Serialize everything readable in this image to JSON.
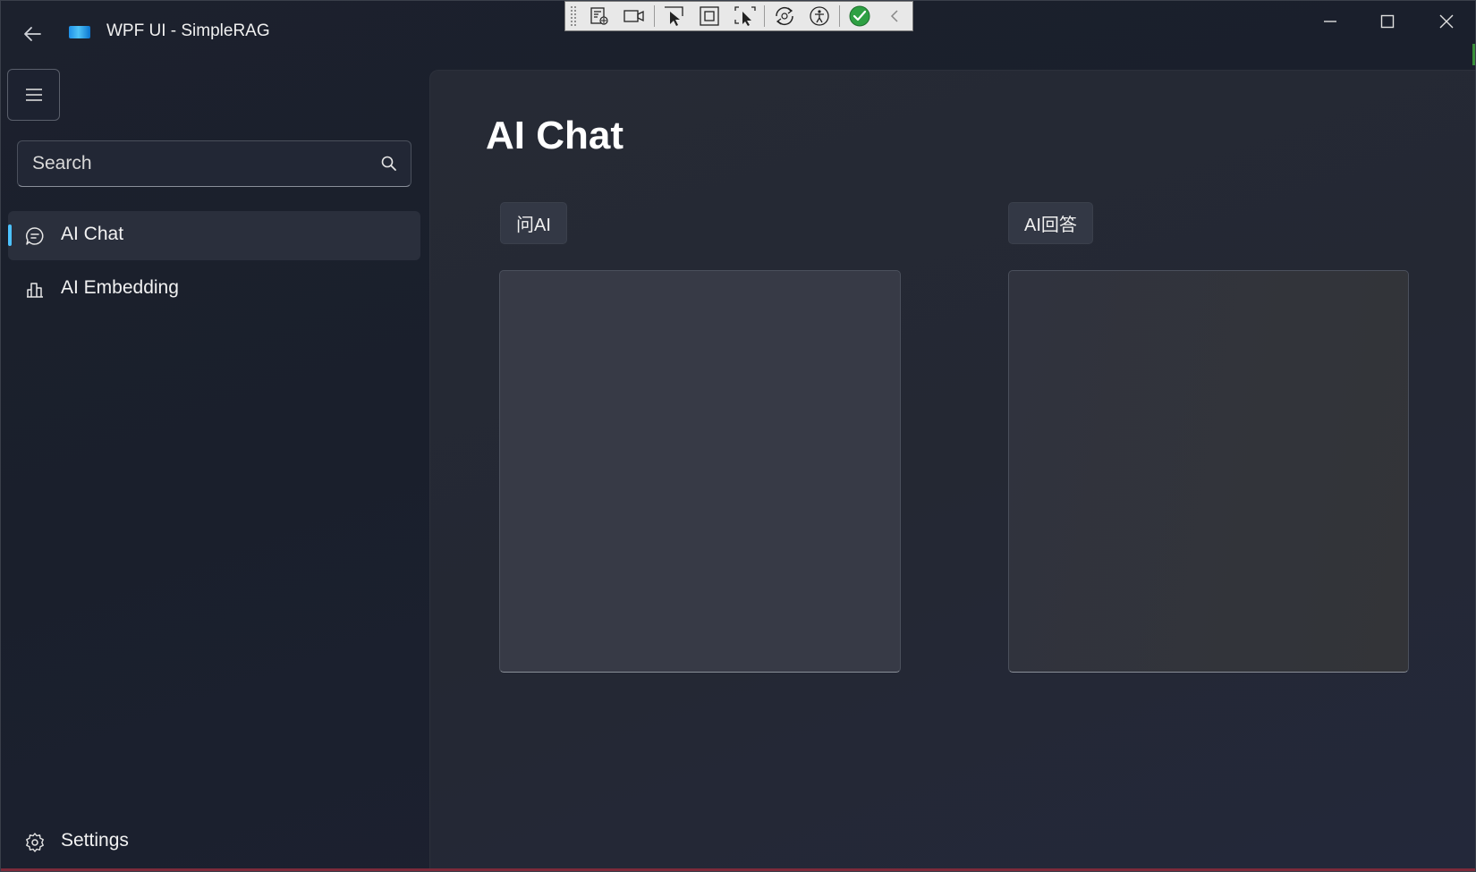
{
  "window": {
    "title": "WPF UI - SimpleRAG",
    "controls": {
      "minimize": "minimize-icon",
      "maximize": "maximize-icon",
      "close": "close-icon"
    }
  },
  "debug_toolbar": {
    "buttons": [
      "live-visual-tree-icon",
      "record-icon",
      "select-element-icon",
      "display-layout-adorners-icon",
      "track-focus-icon",
      "hot-reload-icon",
      "accessibility-icon",
      "binding-check-icon",
      "collapse-chevron-icon"
    ]
  },
  "sidebar": {
    "menu_icon": "hamburger-icon",
    "search": {
      "placeholder": "Search"
    },
    "items": [
      {
        "label": "AI Chat",
        "icon": "chat-bubble-icon",
        "active": true
      },
      {
        "label": "AI Embedding",
        "icon": "bar-chart-icon",
        "active": false
      }
    ],
    "footer": {
      "label": "Settings",
      "icon": "gear-icon"
    }
  },
  "main": {
    "page_title": "AI Chat",
    "ask_button": "问AI",
    "answer_button": "AI回答",
    "question_box": {
      "value": ""
    },
    "answer_box": {
      "value": ""
    }
  },
  "colors": {
    "accent": "#4cc2ff",
    "window_background": "#1a1f2b",
    "content_background": "#252a35"
  }
}
